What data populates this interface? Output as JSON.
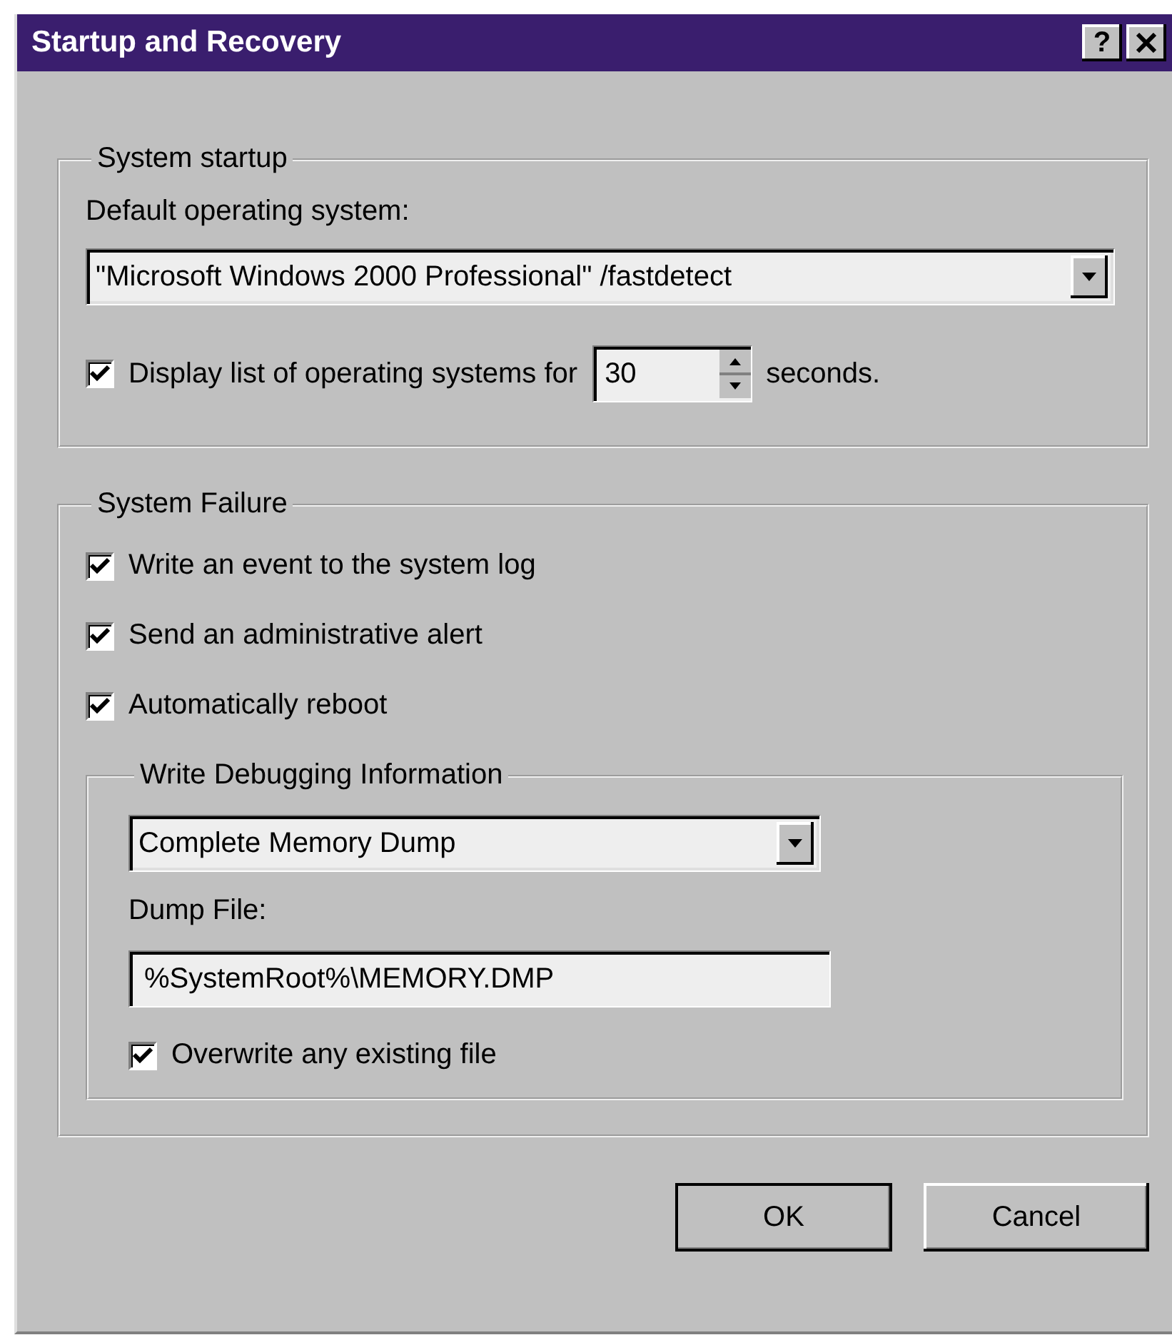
{
  "window": {
    "title": "Startup and Recovery",
    "help_button": "?"
  },
  "system_startup": {
    "legend": "System startup",
    "default_os_label": "Default operating system:",
    "default_os_value": "\"Microsoft Windows 2000 Professional\" /fastdetect",
    "display_list": {
      "checked": true,
      "label": "Display list of operating systems for",
      "seconds_value": "30",
      "suffix": "seconds."
    }
  },
  "system_failure": {
    "legend": "System Failure",
    "options": [
      {
        "label": "Write an event to the system log",
        "checked": true
      },
      {
        "label": "Send an administrative alert",
        "checked": true
      },
      {
        "label": "Automatically reboot",
        "checked": true
      }
    ],
    "debugging": {
      "legend": "Write Debugging Information",
      "dump_type": "Complete Memory Dump",
      "dump_file_label": "Dump File:",
      "dump_file_value": "%SystemRoot%\\MEMORY.DMP",
      "overwrite": {
        "label": "Overwrite any existing file",
        "checked": true
      }
    }
  },
  "buttons": [
    {
      "label": "OK",
      "default": true
    },
    {
      "label": "Cancel",
      "default": false
    }
  ]
}
